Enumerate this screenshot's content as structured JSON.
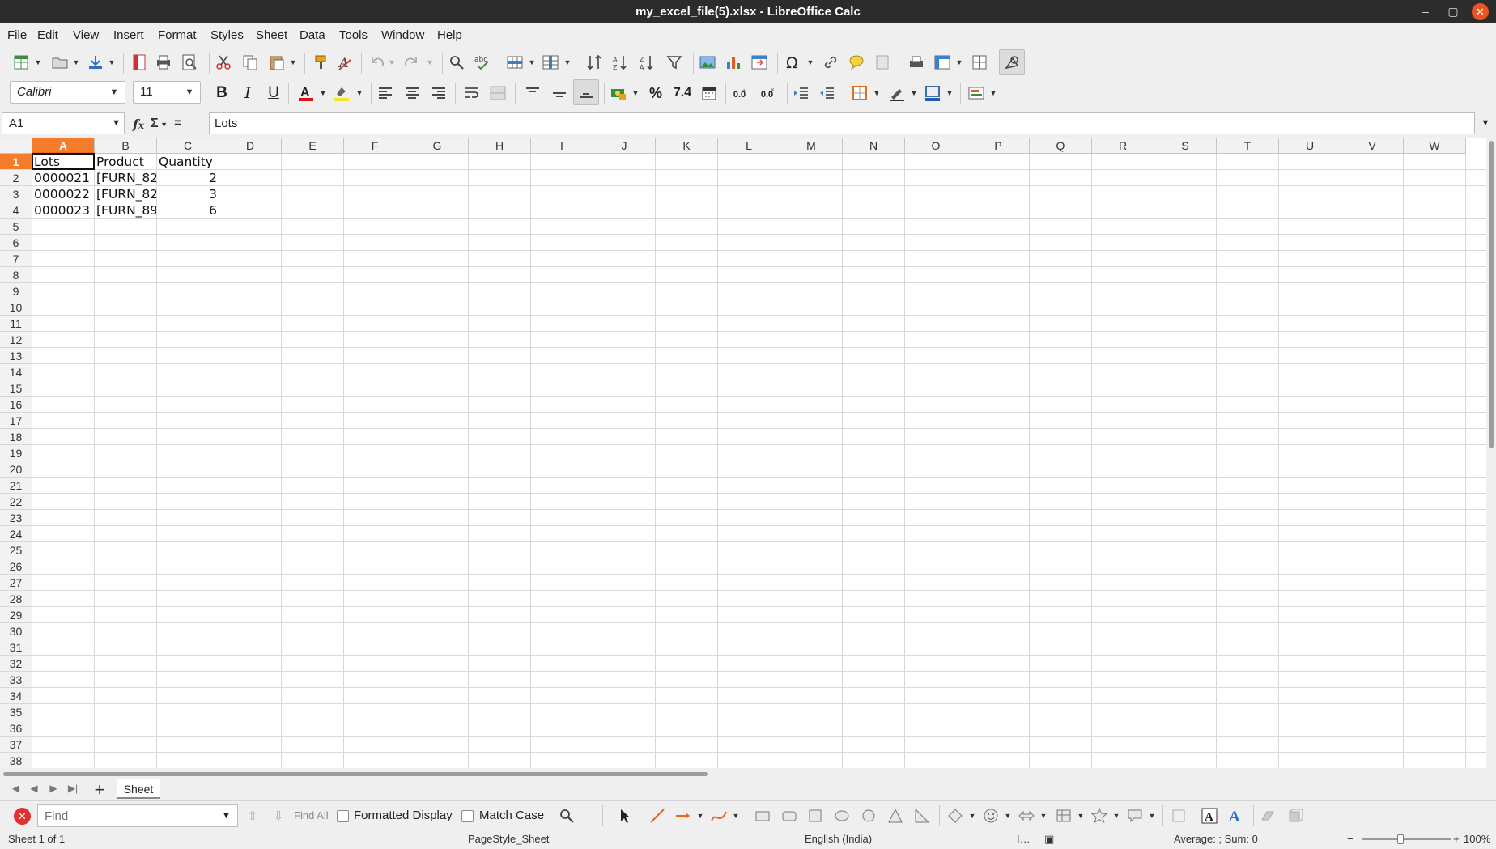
{
  "window": {
    "title": "my_excel_file(5).xlsx - LibreOffice Calc"
  },
  "menu": [
    "File",
    "Edit",
    "View",
    "Insert",
    "Format",
    "Styles",
    "Sheet",
    "Data",
    "Tools",
    "Window",
    "Help"
  ],
  "toolbar": {
    "font_name": "Calibri",
    "font_size": "11",
    "bold": "B",
    "italic": "I",
    "underline": "U",
    "percent": "%",
    "number_format": "7.4"
  },
  "formula_bar": {
    "cell_ref": "A1",
    "content": "Lots"
  },
  "sheet": {
    "columns": [
      "A",
      "B",
      "C",
      "D",
      "E",
      "F",
      "G",
      "H",
      "I",
      "J",
      "K",
      "L",
      "M",
      "N",
      "O",
      "P",
      "Q",
      "R",
      "S",
      "T",
      "U",
      "V",
      "W"
    ],
    "row_numbers": [
      "1",
      "2",
      "3",
      "4",
      "5",
      "6",
      "7",
      "8",
      "9",
      "10",
      "11",
      "12",
      "13",
      "14",
      "15",
      "16",
      "17",
      "18",
      "19",
      "20",
      "21",
      "22",
      "23",
      "24",
      "25",
      "26",
      "27",
      "28",
      "29",
      "30",
      "31",
      "32",
      "33",
      "34",
      "35",
      "36",
      "37",
      "38"
    ],
    "headers": [
      "Lots",
      "Product",
      "Quantity"
    ],
    "rows": [
      {
        "lots": "0000021",
        "product": "[FURN_82",
        "quantity": "2"
      },
      {
        "lots": "0000022",
        "product": "[FURN_82",
        "quantity": "3"
      },
      {
        "lots": "0000023",
        "product": "[FURN_89",
        "quantity": "6"
      }
    ],
    "tab_name": "Sheet"
  },
  "find_bar": {
    "placeholder": "Find",
    "find_all": "Find All",
    "formatted_display": "Formatted Display",
    "match_case": "Match Case"
  },
  "status": {
    "sheet_info": "Sheet 1 of 1",
    "page_style": "PageStyle_Sheet",
    "language": "English (India)",
    "summary": "Average: ; Sum: 0",
    "zoom": "100%"
  },
  "colors": {
    "titlebar": "#2c2c2c",
    "selection_header": "#f57c2a",
    "close_button": "#e95420"
  }
}
